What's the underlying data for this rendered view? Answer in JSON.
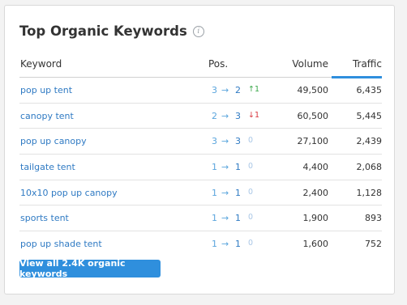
{
  "title": "Top Organic Keywords",
  "info_icon": "info-icon",
  "columns": {
    "keyword": "Keyword",
    "pos": "Pos.",
    "volume": "Volume",
    "traffic": "Traffic"
  },
  "rows": [
    {
      "keyword": "pop up tent",
      "pos_from": "3",
      "arrow": "→",
      "pos_to": "2",
      "change": "↑1",
      "change_type": "up",
      "volume": "49,500",
      "traffic": "6,435"
    },
    {
      "keyword": "canopy tent",
      "pos_from": "2",
      "arrow": "→",
      "pos_to": "3",
      "change": "↓1",
      "change_type": "down",
      "volume": "60,500",
      "traffic": "5,445"
    },
    {
      "keyword": "pop up canopy",
      "pos_from": "3",
      "arrow": "→",
      "pos_to": "3",
      "change": "0",
      "change_type": "zero",
      "volume": "27,100",
      "traffic": "2,439"
    },
    {
      "keyword": "tailgate tent",
      "pos_from": "1",
      "arrow": "→",
      "pos_to": "1",
      "change": "0",
      "change_type": "zero",
      "volume": "4,400",
      "traffic": "2,068"
    },
    {
      "keyword": "10x10 pop up canopy",
      "pos_from": "1",
      "arrow": "→",
      "pos_to": "1",
      "change": "0",
      "change_type": "zero",
      "volume": "2,400",
      "traffic": "1,128"
    },
    {
      "keyword": "sports tent",
      "pos_from": "1",
      "arrow": "→",
      "pos_to": "1",
      "change": "0",
      "change_type": "zero",
      "volume": "1,900",
      "traffic": "893"
    },
    {
      "keyword": "pop up shade tent",
      "pos_from": "1",
      "arrow": "→",
      "pos_to": "1",
      "change": "0",
      "change_type": "zero",
      "volume": "1,600",
      "traffic": "752"
    }
  ],
  "button_label": "View all 2.4K organic keywords",
  "colors": {
    "accent": "#2f8fdd",
    "link": "#2f7ac3",
    "up": "#3aa84a",
    "down": "#d9363e"
  }
}
